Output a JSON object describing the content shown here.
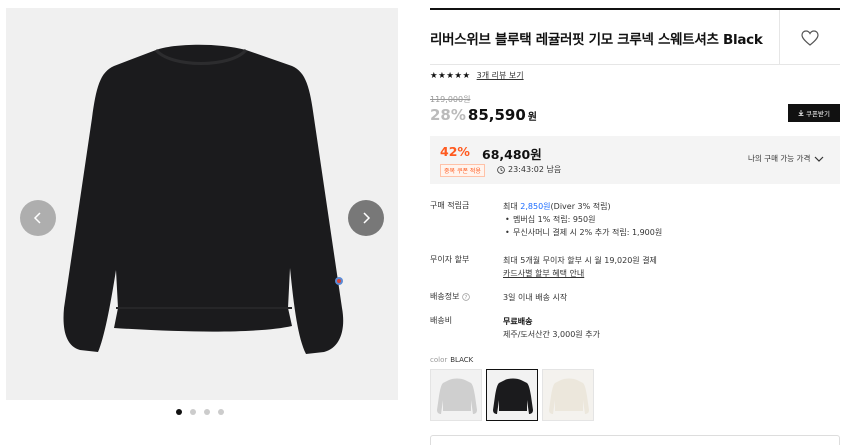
{
  "gallery": {
    "prev_icon": "chevron-left-icon",
    "next_icon": "chevron-right-icon",
    "image_count": 4,
    "active_index": 0
  },
  "product": {
    "title": "리버스위브 블루택 레귤러핏 기모 크루넥 스웨트셔츠 Black",
    "like_icon": "heart-icon",
    "rating_stars": "★★★★★",
    "review_link": "3개 리뷰 보기",
    "original_price": "119,000원",
    "discount_rate": "28%",
    "sale_price": "85,590",
    "sale_price_unit": "원",
    "coupon_button": "쿠폰받기"
  },
  "best_price": {
    "discount_rate": "42%",
    "price": "68,480원",
    "tag": "중복 쿠폰 적용",
    "timer": "23:43:02 남음",
    "label": "나의 구매 가능 가격"
  },
  "info": {
    "points": {
      "key": "구매 적립금",
      "line1_prefix": "최대 ",
      "line1_amount": "2,850원",
      "line1_suffix": "(Diver 3% 적립)",
      "bullet1": "멤버십 1% 적립: 950원",
      "bullet2": "무신사머니 결제 시 2% 추가 적립: 1,900원"
    },
    "installment": {
      "key": "무이자 할부",
      "line1": "최대 5개월 무이자 할부 시 월 19,020원 결제",
      "link": "카드사별 할부 혜택 안내"
    },
    "shipping_info": {
      "key": "배송정보",
      "value": "3일 이내 배송 시작"
    },
    "shipping_fee": {
      "key": "배송비",
      "value": "무료배송",
      "sub": "제주/도서산간 3,000원 추가"
    }
  },
  "color": {
    "label": "color",
    "value": "BLACK",
    "options": [
      "gray",
      "black",
      "ivory"
    ],
    "selected": "black"
  },
  "colors": {
    "accent": "#ff5a1f",
    "link": "#1a6bff",
    "sweater": "#1b1b1d"
  }
}
